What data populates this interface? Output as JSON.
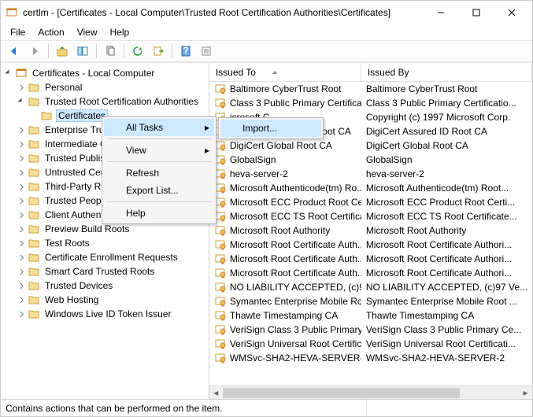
{
  "window": {
    "title": "certlm - [Certificates - Local Computer\\Trusted Root Certification Authorities\\Certificates]"
  },
  "menubar": {
    "file": "File",
    "action": "Action",
    "view": "View",
    "help": "Help"
  },
  "tree": {
    "root": "Certificates - Local Computer",
    "items": [
      "Personal",
      "Trusted Root Certification Authorities",
      "Certificates",
      "Enterprise Trust",
      "Intermediate C",
      "Trusted Publish",
      "Untrusted Certi",
      "Third-Party Ro",
      "Trusted People",
      "Client Authenti",
      "Preview Build Roots",
      "Test Roots",
      "Certificate Enrollment Requests",
      "Smart Card Trusted Roots",
      "Trusted Devices",
      "Web Hosting",
      "Windows Live ID Token Issuer"
    ]
  },
  "ctx1": {
    "all_tasks": "All Tasks",
    "view": "View",
    "refresh": "Refresh",
    "export_list": "Export List...",
    "help": "Help"
  },
  "ctx2": {
    "import": "Import..."
  },
  "columns": {
    "issued_to": "Issued To",
    "issued_by": "Issued By"
  },
  "rows": [
    {
      "to": "Baltimore CyberTrust Root",
      "by": "Baltimore CyberTrust Root"
    },
    {
      "to": "Class 3 Public Primary Certificat...",
      "by": "Class 3 Public Primary Certificatio..."
    },
    {
      "to": "icrosoft C...",
      "by": "Copyright (c) 1997 Microsoft Corp."
    },
    {
      "to": "DigiCert Assured ID Root CA",
      "by": "DigiCert Assured ID Root CA"
    },
    {
      "to": "DigiCert Global Root CA",
      "by": "DigiCert Global Root CA"
    },
    {
      "to": "GlobalSign",
      "by": "GlobalSign"
    },
    {
      "to": "heva-server-2",
      "by": "heva-server-2"
    },
    {
      "to": "Microsoft Authenticode(tm) Ro...",
      "by": "Microsoft Authenticode(tm) Root..."
    },
    {
      "to": "Microsoft ECC Product Root Ce...",
      "by": "Microsoft ECC Product Root Certi..."
    },
    {
      "to": "Microsoft ECC TS Root Certifica...",
      "by": "Microsoft ECC TS Root Certificate..."
    },
    {
      "to": "Microsoft Root Authority",
      "by": "Microsoft Root Authority"
    },
    {
      "to": "Microsoft Root Certificate Auth...",
      "by": "Microsoft Root Certificate Authori..."
    },
    {
      "to": "Microsoft Root Certificate Auth...",
      "by": "Microsoft Root Certificate Authori..."
    },
    {
      "to": "Microsoft Root Certificate Auth...",
      "by": "Microsoft Root Certificate Authori..."
    },
    {
      "to": "NO LIABILITY ACCEPTED, (c)97 ...",
      "by": "NO LIABILITY ACCEPTED, (c)97 Ve..."
    },
    {
      "to": "Symantec Enterprise Mobile Ro...",
      "by": "Symantec Enterprise Mobile Root ..."
    },
    {
      "to": "Thawte Timestamping CA",
      "by": "Thawte Timestamping CA"
    },
    {
      "to": "VeriSign Class 3 Public Primary ...",
      "by": "VeriSign Class 3 Public Primary Ce..."
    },
    {
      "to": "VeriSign Universal Root Certific...",
      "by": "VeriSign Universal Root Certificati..."
    },
    {
      "to": "WMSvc-SHA2-HEVA-SERVER-2",
      "by": "WMSvc-SHA2-HEVA-SERVER-2"
    }
  ],
  "status": {
    "text": "Contains actions that can be performed on the item."
  }
}
